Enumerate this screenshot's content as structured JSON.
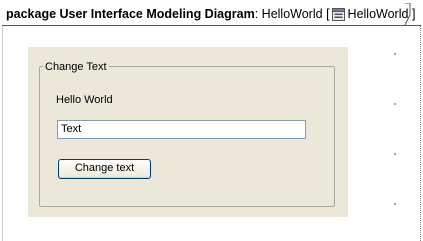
{
  "diagram": {
    "header_keyword": "package User Interface Modeling Diagram",
    "header_separator": ":",
    "header_name": "HelloWorld",
    "header_bracket_open": "[",
    "header_icon": "ui-diagram-icon",
    "header_context": "HelloWorld",
    "header_bracket_close": "]"
  },
  "form": {
    "group_title": "Change Text",
    "label": "Hello World",
    "text_field_value": "Text",
    "button_label": "Change text"
  },
  "colors": {
    "panel_background": "#ebe8da",
    "group_border": "#a9a99a",
    "input_border": "#7f9db9",
    "button_border": "#003c74"
  }
}
